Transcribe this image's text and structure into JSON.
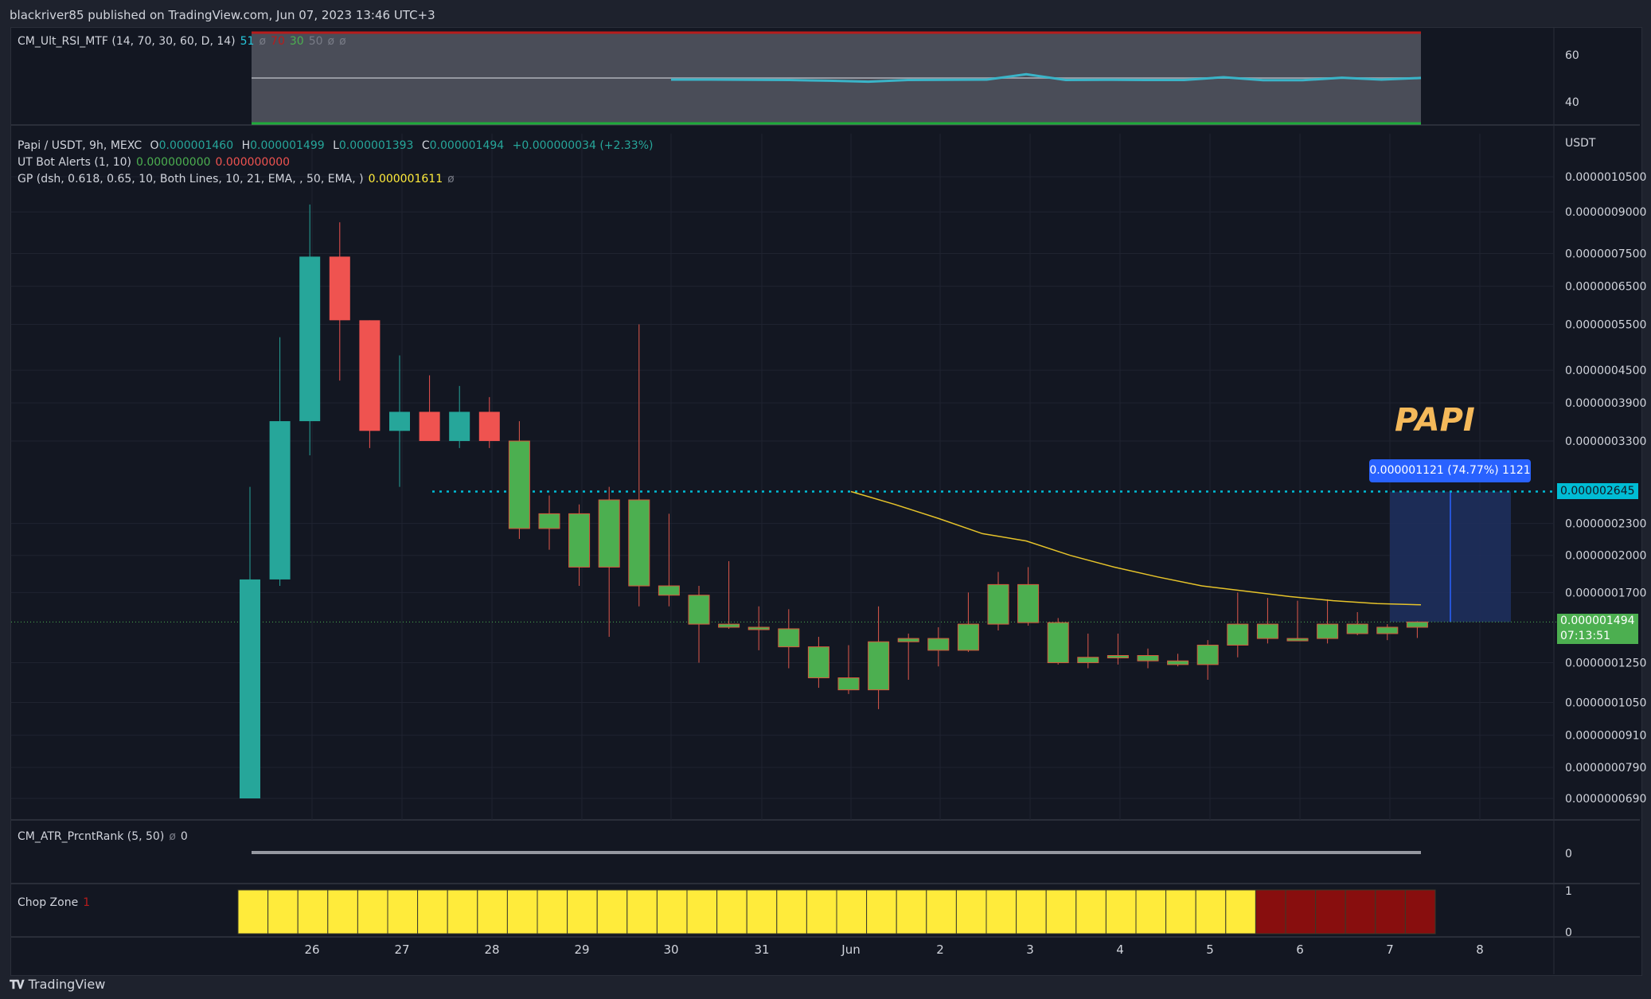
{
  "header": {
    "published": "blackriver85 published on TradingView.com, Jun 07, 2023 13:46 UTC+3"
  },
  "footer": {
    "brand": "TradingView"
  },
  "rsi_pane": {
    "name": "CM_Ult_RSI_MTF (14, 70, 30, 60, D, 14)",
    "v1": "51",
    "v2": "ø",
    "v3": "70",
    "v4": "30",
    "v5": "50",
    "v6": "ø",
    "v7": "ø",
    "ticks": [
      "60",
      "40"
    ],
    "line_values": [
      49.5,
      49.5,
      49.4,
      49.3,
      49.0,
      48.6,
      49.3,
      49.4,
      49.5,
      51.8,
      49.3,
      49.4,
      49.3,
      49.3,
      50.5,
      49.2,
      49.2,
      50.3,
      49.5,
      50.2
    ]
  },
  "main_pane": {
    "symbol": "Papi / USDT, 9h, MEXC",
    "O": "0.000001460",
    "H": "0.000001499",
    "L": "0.000001393",
    "C": "0.000001494",
    "change": "+0.000000034 (+2.33%)",
    "ut_bot": "UT Bot Alerts (1, 10)",
    "ut_v1": "0.000000000",
    "ut_v2": "0.000000000",
    "gp": "GP (dsh, 0.618, 0.65, 10, Both Lines, 10, 21, EMA, , 50, EMA, )",
    "gp_val": "0.000001611",
    "gp_extra": "ø",
    "currency": "USDT",
    "annotation": "PAPI",
    "position_label": "0.000001121 (74.77%) 1121",
    "dotted_level_label": "0.000002645",
    "last_price": "0.000001494",
    "countdown": "07:13:51"
  },
  "atr_pane": {
    "name": "CM_ATR_PrcntRank (5, 50)",
    "v1": "ø",
    "v2": "0",
    "tick": "0"
  },
  "chop_pane": {
    "name": "Chop Zone",
    "v1": "1",
    "ticks": [
      "1",
      "0"
    ],
    "bars": [
      "yellow",
      "yellow",
      "yellow",
      "yellow",
      "yellow",
      "yellow",
      "yellow",
      "yellow",
      "yellow",
      "yellow",
      "yellow",
      "yellow",
      "yellow",
      "yellow",
      "yellow",
      "yellow",
      "yellow",
      "yellow",
      "yellow",
      "yellow",
      "yellow",
      "yellow",
      "yellow",
      "yellow",
      "yellow",
      "yellow",
      "yellow",
      "yellow",
      "yellow",
      "yellow",
      "yellow",
      "yellow",
      "yellow",
      "yellow",
      "darkred",
      "darkred",
      "darkred",
      "darkred",
      "darkred",
      "darkred"
    ]
  },
  "colors": {
    "up": "#26a69a",
    "down": "#ef5350",
    "green": "#4caf50",
    "yellow": "#ffeb3b",
    "darkred": "#880e0e",
    "ema": "#e6c32a",
    "rsi": "#3ab4c8",
    "position_fill": "#1e2f5c"
  },
  "chart_data": {
    "type": "candlestick",
    "x_ticks": [
      "26",
      "27",
      "28",
      "29",
      "30",
      "31",
      "Jun",
      "2",
      "3",
      "4",
      "5",
      "6",
      "7",
      "8"
    ],
    "y_ticks": [
      "0.0000010500",
      "0.0000009000",
      "0.0000007500",
      "0.0000006500",
      "0.0000005500",
      "0.0000004500",
      "0.0000003900",
      "0.0000003300",
      "0.0000002300",
      "0.0000002000",
      "0.0000001700",
      "0.0000001250",
      "0.0000001050",
      "0.0000000910",
      "0.0000000790",
      "0.0000000690"
    ],
    "y_tick_values": [
      1.05e-05,
      9e-06,
      7.5e-06,
      6.5e-06,
      5.5e-06,
      4.5e-06,
      3.9e-06,
      3.3e-06,
      2.3e-06,
      2e-06,
      1.7e-06,
      1.25e-06,
      1.05e-06,
      9.1e-07,
      7.9e-07,
      6.9e-07
    ],
    "scale": "log",
    "dotted_level": 2.645e-06,
    "last_price": 1.494e-06,
    "candles": [
      {
        "o": 6.9e-07,
        "h": 2.7e-06,
        "l": 6.9e-07,
        "c": 1.8e-06,
        "color": "up"
      },
      {
        "o": 1.8e-06,
        "h": 5.2e-06,
        "l": 1.75e-06,
        "c": 3.6e-06,
        "color": "up"
      },
      {
        "o": 3.6e-06,
        "h": 9.3e-06,
        "l": 3.1e-06,
        "c": 7.4e-06,
        "color": "up"
      },
      {
        "o": 7.4e-06,
        "h": 8.6e-06,
        "l": 4.3e-06,
        "c": 5.6e-06,
        "color": "down"
      },
      {
        "o": 5.6e-06,
        "h": 5.6e-06,
        "l": 3.2e-06,
        "c": 3.45e-06,
        "color": "down"
      },
      {
        "o": 3.45e-06,
        "h": 4.8e-06,
        "l": 2.7e-06,
        "c": 3.75e-06,
        "color": "up"
      },
      {
        "o": 3.75e-06,
        "h": 4.4e-06,
        "l": 3.4e-06,
        "c": 3.3e-06,
        "color": "down"
      },
      {
        "o": 3.3e-06,
        "h": 4.2e-06,
        "l": 3.2e-06,
        "c": 3.75e-06,
        "color": "up"
      },
      {
        "o": 3.75e-06,
        "h": 4e-06,
        "l": 3.2e-06,
        "c": 3.3e-06,
        "color": "down"
      },
      {
        "o": 3.3e-06,
        "h": 3.6e-06,
        "l": 2.15e-06,
        "c": 2.25e-06,
        "color": "green"
      },
      {
        "o": 2.25e-06,
        "h": 2.6e-06,
        "l": 2.05e-06,
        "c": 2.4e-06,
        "color": "green"
      },
      {
        "o": 2.4e-06,
        "h": 2.5e-06,
        "l": 1.75e-06,
        "c": 1.9e-06,
        "color": "green"
      },
      {
        "o": 1.9e-06,
        "h": 2.7e-06,
        "l": 1.4e-06,
        "c": 2.55e-06,
        "color": "green"
      },
      {
        "o": 2.55e-06,
        "h": 5.5e-06,
        "l": 1.6e-06,
        "c": 1.75e-06,
        "color": "green"
      },
      {
        "o": 1.75e-06,
        "h": 2.4e-06,
        "l": 1.6e-06,
        "c": 1.68e-06,
        "color": "green"
      },
      {
        "o": 1.68e-06,
        "h": 1.75e-06,
        "l": 1.25e-06,
        "c": 1.48e-06,
        "color": "green"
      },
      {
        "o": 1.48e-06,
        "h": 1.95e-06,
        "l": 1.45e-06,
        "c": 1.46e-06,
        "color": "green"
      },
      {
        "o": 1.46e-06,
        "h": 1.6e-06,
        "l": 1.32e-06,
        "c": 1.45e-06,
        "color": "green"
      },
      {
        "o": 1.45e-06,
        "h": 1.58e-06,
        "l": 1.22e-06,
        "c": 1.34e-06,
        "color": "green"
      },
      {
        "o": 1.34e-06,
        "h": 1.4e-06,
        "l": 1.12e-06,
        "c": 1.17e-06,
        "color": "green"
      },
      {
        "o": 1.17e-06,
        "h": 1.35e-06,
        "l": 1.09e-06,
        "c": 1.11e-06,
        "color": "green"
      },
      {
        "o": 1.11e-06,
        "h": 1.6e-06,
        "l": 1.02e-06,
        "c": 1.37e-06,
        "color": "green"
      },
      {
        "o": 1.37e-06,
        "h": 1.42e-06,
        "l": 1.16e-06,
        "c": 1.39e-06,
        "color": "green"
      },
      {
        "o": 1.39e-06,
        "h": 1.46e-06,
        "l": 1.23e-06,
        "c": 1.32e-06,
        "color": "green"
      },
      {
        "o": 1.32e-06,
        "h": 1.7e-06,
        "l": 1.31e-06,
        "c": 1.48e-06,
        "color": "green"
      },
      {
        "o": 1.48e-06,
        "h": 1.86e-06,
        "l": 1.44e-06,
        "c": 1.76e-06,
        "color": "green"
      },
      {
        "o": 1.76e-06,
        "h": 1.9e-06,
        "l": 1.47e-06,
        "c": 1.49e-06,
        "color": "green"
      },
      {
        "o": 1.49e-06,
        "h": 1.52e-06,
        "l": 1.24e-06,
        "c": 1.25e-06,
        "color": "green"
      },
      {
        "o": 1.25e-06,
        "h": 1.42e-06,
        "l": 1.22e-06,
        "c": 1.28e-06,
        "color": "green"
      },
      {
        "o": 1.28e-06,
        "h": 1.42e-06,
        "l": 1.24e-06,
        "c": 1.29e-06,
        "color": "green"
      },
      {
        "o": 1.29e-06,
        "h": 1.33e-06,
        "l": 1.22e-06,
        "c": 1.26e-06,
        "color": "green"
      },
      {
        "o": 1.26e-06,
        "h": 1.3e-06,
        "l": 1.23e-06,
        "c": 1.24e-06,
        "color": "green"
      },
      {
        "o": 1.24e-06,
        "h": 1.38e-06,
        "l": 1.16e-06,
        "c": 1.35e-06,
        "color": "green"
      },
      {
        "o": 1.35e-06,
        "h": 1.7e-06,
        "l": 1.28e-06,
        "c": 1.48e-06,
        "color": "green"
      },
      {
        "o": 1.48e-06,
        "h": 1.66e-06,
        "l": 1.36e-06,
        "c": 1.39e-06,
        "color": "green"
      },
      {
        "o": 1.39e-06,
        "h": 1.64e-06,
        "l": 1.38e-06,
        "c": 1.39e-06,
        "color": "green"
      },
      {
        "o": 1.39e-06,
        "h": 1.65e-06,
        "l": 1.36e-06,
        "c": 1.48e-06,
        "color": "green"
      },
      {
        "o": 1.48e-06,
        "h": 1.56e-06,
        "l": 1.41e-06,
        "c": 1.42e-06,
        "color": "green"
      },
      {
        "o": 1.42e-06,
        "h": 1.48e-06,
        "l": 1.38e-06,
        "c": 1.46e-06,
        "color": "green"
      },
      {
        "o": 1.46e-06,
        "h": 1.499e-06,
        "l": 1.393e-06,
        "c": 1.494e-06,
        "color": "green"
      }
    ],
    "ema": [
      2.645e-06,
      2.5e-06,
      2.35e-06,
      2.2e-06,
      2.13e-06,
      2e-06,
      1.9e-06,
      1.82e-06,
      1.75e-06,
      1.71e-06,
      1.67e-06,
      1.64e-06,
      1.62e-06,
      1.611e-06
    ],
    "position": {
      "entry": 1.494e-06,
      "target": 2.645e-06,
      "pct": 74.77
    }
  }
}
